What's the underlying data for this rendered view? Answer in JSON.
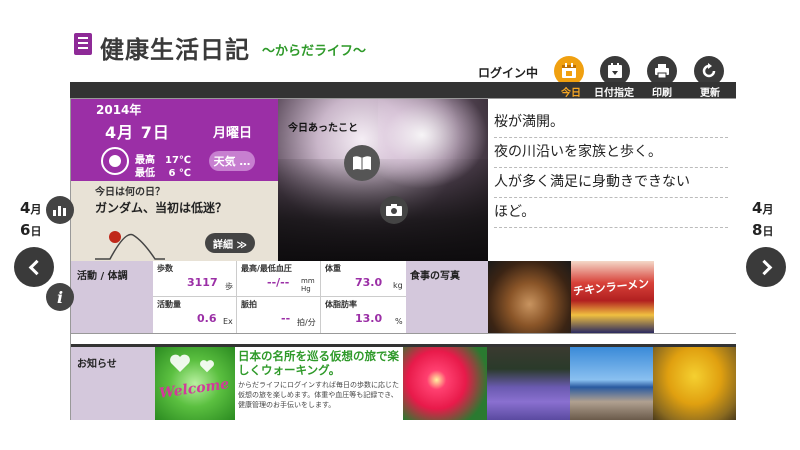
{
  "app": {
    "title": "健康生活日記",
    "subtitle": "～からだライフ～"
  },
  "header": {
    "login_status": "ログイン中",
    "tools": [
      {
        "label": "今日",
        "icon": "calendar-today-icon",
        "active": true
      },
      {
        "label": "日付指定",
        "icon": "calendar-select-icon",
        "active": false
      },
      {
        "label": "印刷",
        "icon": "printer-icon",
        "active": false
      },
      {
        "label": "更新",
        "icon": "refresh-icon",
        "active": false
      }
    ]
  },
  "nav": {
    "prev": {
      "month": "4",
      "month_unit": "月",
      "day": "6",
      "day_unit": "日"
    },
    "next": {
      "month": "4",
      "month_unit": "月",
      "day": "8",
      "day_unit": "日"
    }
  },
  "date": {
    "year": "2014年",
    "month_day": "4月 7日",
    "weekday": "月曜日",
    "temp_high": "最高　17℃",
    "temp_low": "最低　 6 ℃",
    "weather_button": "天気 …"
  },
  "today_trivia": {
    "question": "今日は何の日？",
    "answer": "ガンダム、当初は低迷？",
    "detail_button": "詳細 ≫"
  },
  "photo": {
    "label": "今日あったこと"
  },
  "diary": {
    "lines": [
      "桜が満開。",
      "夜の川沿いを家族と歩く。",
      "人が多く満足に身動きできない",
      "ほど。"
    ]
  },
  "activity": {
    "label": "活動 / 体調",
    "steps": {
      "title": "歩数",
      "value": "3117",
      "unit": "歩"
    },
    "blood_pressure": {
      "title": "最高/最低血圧",
      "value": "--/--",
      "unit": "mm\nHg"
    },
    "weight": {
      "title": "体重",
      "value": "73.0",
      "unit": "kg"
    },
    "activity_amount": {
      "title": "活動量",
      "value": "0.6",
      "unit": "Ex"
    },
    "pulse": {
      "title": "脈拍",
      "value": "--",
      "unit": "拍/分"
    },
    "body_fat": {
      "title": "体脂肪率",
      "value": "13.0",
      "unit": "%"
    }
  },
  "meals": {
    "label": "食事の写真",
    "photo2_text": "チキンラーメン"
  },
  "news": {
    "label": "お知らせ",
    "welcome": "Welcome",
    "promo_heading": "日本の名所を巡る仮想の旅で楽しくウォーキング。",
    "promo_body": "からだライフにログインすれば毎日の歩数に応じた仮想の旅を楽しめます。体重や血圧等も記録でき、健康管理のお手伝いをします。"
  },
  "colors": {
    "accent_purple": "#9b2fa6",
    "active_orange": "#f0a010",
    "green": "#2f9a2a"
  }
}
